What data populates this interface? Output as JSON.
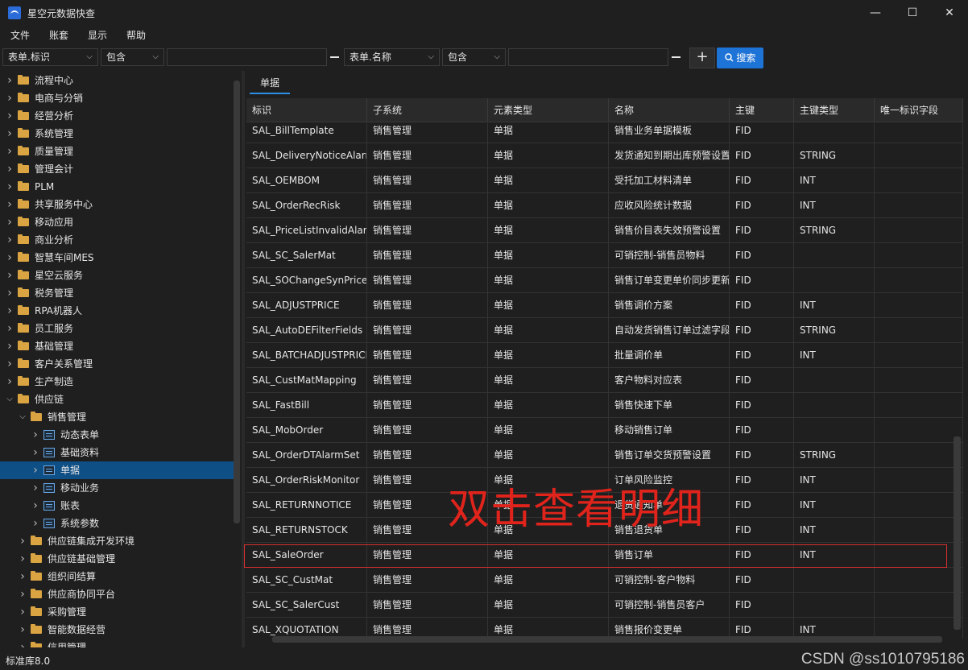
{
  "window": {
    "title": "星空元数据快查",
    "minimize": "—",
    "maximize": "☐",
    "close": "✕"
  },
  "menu": [
    "文件",
    "账套",
    "显示",
    "帮助"
  ],
  "filter": {
    "field1": "表单.标识",
    "op1": "包含",
    "value1": "",
    "field2": "表单.名称",
    "op2": "包含",
    "value2": "",
    "add_label": "+",
    "search_label": "搜索",
    "search_icon": "search-icon"
  },
  "tree": {
    "items": [
      {
        "label": "流程中心",
        "level": 0,
        "expanded": false
      },
      {
        "label": "电商与分销",
        "level": 0,
        "expanded": false
      },
      {
        "label": "经营分析",
        "level": 0,
        "expanded": false
      },
      {
        "label": "系统管理",
        "level": 0,
        "expanded": false
      },
      {
        "label": "质量管理",
        "level": 0,
        "expanded": false
      },
      {
        "label": "管理会计",
        "level": 0,
        "expanded": false
      },
      {
        "label": "PLM",
        "level": 0,
        "expanded": false
      },
      {
        "label": "共享服务中心",
        "level": 0,
        "expanded": false
      },
      {
        "label": "移动应用",
        "level": 0,
        "expanded": false
      },
      {
        "label": "商业分析",
        "level": 0,
        "expanded": false
      },
      {
        "label": "智慧车间MES",
        "level": 0,
        "expanded": false
      },
      {
        "label": "星空云服务",
        "level": 0,
        "expanded": false
      },
      {
        "label": "税务管理",
        "level": 0,
        "expanded": false
      },
      {
        "label": "RPA机器人",
        "level": 0,
        "expanded": false
      },
      {
        "label": "员工服务",
        "level": 0,
        "expanded": false
      },
      {
        "label": "基础管理",
        "level": 0,
        "expanded": false
      },
      {
        "label": "客户关系管理",
        "level": 0,
        "expanded": false
      },
      {
        "label": "生产制造",
        "level": 0,
        "expanded": false
      },
      {
        "label": "供应链",
        "level": 0,
        "expanded": true
      },
      {
        "label": "销售管理",
        "level": 1,
        "expanded": true
      },
      {
        "label": "动态表单",
        "level": 2,
        "expanded": false,
        "icon": "form"
      },
      {
        "label": "基础资料",
        "level": 2,
        "expanded": false,
        "icon": "form"
      },
      {
        "label": "单据",
        "level": 2,
        "expanded": false,
        "icon": "form",
        "selected": true
      },
      {
        "label": "移动业务",
        "level": 2,
        "expanded": false,
        "icon": "form"
      },
      {
        "label": "账表",
        "level": 2,
        "expanded": false,
        "icon": "form"
      },
      {
        "label": "系统参数",
        "level": 2,
        "expanded": false,
        "icon": "form"
      },
      {
        "label": "供应链集成开发环境",
        "level": 1,
        "expanded": false
      },
      {
        "label": "供应链基础管理",
        "level": 1,
        "expanded": false
      },
      {
        "label": "组织间结算",
        "level": 1,
        "expanded": false
      },
      {
        "label": "供应商协同平台",
        "level": 1,
        "expanded": false
      },
      {
        "label": "采购管理",
        "level": 1,
        "expanded": false
      },
      {
        "label": "智能数据经营",
        "level": 1,
        "expanded": false
      },
      {
        "label": "信用管理",
        "level": 1,
        "expanded": false
      }
    ]
  },
  "tab": {
    "label": "单据"
  },
  "grid": {
    "columns": [
      "标识",
      "子系统",
      "元素类型",
      "名称",
      "主键",
      "主键类型",
      "唯一标识字段"
    ],
    "rows": [
      [
        "SAL_BillTemplate",
        "销售管理",
        "单据",
        "销售业务单据模板",
        "FID",
        "",
        ""
      ],
      [
        "SAL_DeliveryNoticeAlarmSet",
        "销售管理",
        "单据",
        "发货通知到期出库预警设置",
        "FID",
        "STRING",
        ""
      ],
      [
        "SAL_OEMBOM",
        "销售管理",
        "单据",
        "受托加工材料清单",
        "FID",
        "INT",
        ""
      ],
      [
        "SAL_OrderRecRisk",
        "销售管理",
        "单据",
        "应收风险统计数据",
        "FID",
        "INT",
        ""
      ],
      [
        "SAL_PriceListInvalidAlarmSet",
        "销售管理",
        "单据",
        "销售价目表失效预警设置",
        "FID",
        "STRING",
        ""
      ],
      [
        "SAL_SC_SalerMat",
        "销售管理",
        "单据",
        "可销控制-销售员物料",
        "FID",
        "",
        ""
      ],
      [
        "SAL_SOChangeSynPrice",
        "销售管理",
        "单据",
        "销售订单变更单价同步更新",
        "FID",
        "",
        ""
      ],
      [
        "SAL_ADJUSTPRICE",
        "销售管理",
        "单据",
        "销售调价方案",
        "FID",
        "INT",
        ""
      ],
      [
        "SAL_AutoDEFilterFields",
        "销售管理",
        "单据",
        "自动发货销售订单过滤字段",
        "FID",
        "STRING",
        ""
      ],
      [
        "SAL_BATCHADJUSTPRICE",
        "销售管理",
        "单据",
        "批量调价单",
        "FID",
        "INT",
        ""
      ],
      [
        "SAL_CustMatMapping",
        "销售管理",
        "单据",
        "客户物料对应表",
        "FID",
        "",
        ""
      ],
      [
        "SAL_FastBill",
        "销售管理",
        "单据",
        "销售快速下单",
        "FID",
        "",
        ""
      ],
      [
        "SAL_MobOrder",
        "销售管理",
        "单据",
        "移动销售订单",
        "FID",
        "",
        ""
      ],
      [
        "SAL_OrderDTAlarmSet",
        "销售管理",
        "单据",
        "销售订单交货预警设置",
        "FID",
        "STRING",
        ""
      ],
      [
        "SAL_OrderRiskMonitor",
        "销售管理",
        "单据",
        "订单风险监控",
        "FID",
        "INT",
        ""
      ],
      [
        "SAL_RETURNNOTICE",
        "销售管理",
        "单据",
        "退货通知单",
        "FID",
        "INT",
        ""
      ],
      [
        "SAL_RETURNSTOCK",
        "销售管理",
        "单据",
        "销售退货单",
        "FID",
        "INT",
        ""
      ],
      [
        "SAL_SaleOrder",
        "销售管理",
        "单据",
        "销售订单",
        "FID",
        "INT",
        ""
      ],
      [
        "SAL_SC_CustMat",
        "销售管理",
        "单据",
        "可销控制-客户物料",
        "FID",
        "",
        ""
      ],
      [
        "SAL_SC_SalerCust",
        "销售管理",
        "单据",
        "可销控制-销售员客户",
        "FID",
        "",
        ""
      ],
      [
        "SAL_XQUOTATION",
        "销售管理",
        "单据",
        "销售报价变更单",
        "FID",
        "INT",
        ""
      ]
    ]
  },
  "annotation": "双击查看明细",
  "status": {
    "text": "标准库8.0"
  },
  "watermark": "CSDN @ss1010795186"
}
